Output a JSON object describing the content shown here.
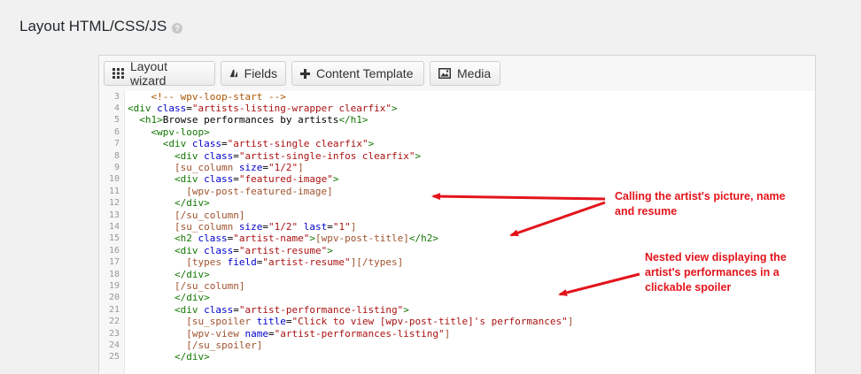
{
  "section": {
    "title": "Layout HTML/CSS/JS",
    "help_icon": "help-icon"
  },
  "toolbar": {
    "buttons": [
      {
        "label": "Layout wizard",
        "icon": "grid-icon"
      },
      {
        "label": "Fields",
        "icon": "fields-icon"
      },
      {
        "label": "Content Template",
        "icon": "plus-icon"
      },
      {
        "label": "Media",
        "icon": "image-icon"
      }
    ]
  },
  "colors": {
    "tag": "#117700",
    "attr": "#0000cc",
    "string": "#aa1111",
    "shortcode": "#a0522d",
    "annotation": "#e3141b"
  },
  "code": {
    "lines": [
      {
        "n": "3",
        "indent": "    ",
        "tokens": [
          [
            "cmt",
            "<!-- wpv-loop-start -->"
          ]
        ]
      },
      {
        "n": "4",
        "indent": "",
        "tokens": [
          [
            "tag",
            "<div "
          ],
          [
            "attr",
            "class"
          ],
          [
            "txt",
            "="
          ],
          [
            "str",
            "\"artists-listing-wrapper clearfix\""
          ],
          [
            "tag",
            ">"
          ]
        ]
      },
      {
        "n": "5",
        "indent": "  ",
        "tokens": [
          [
            "tag",
            "<h1>"
          ],
          [
            "txt",
            "Browse performances by artists"
          ],
          [
            "tag",
            "</h1>"
          ]
        ]
      },
      {
        "n": "6",
        "indent": "    ",
        "tokens": [
          [
            "tag",
            "<wpv-loop>"
          ]
        ]
      },
      {
        "n": "7",
        "indent": "      ",
        "tokens": [
          [
            "tag",
            "<div "
          ],
          [
            "attr",
            "class"
          ],
          [
            "txt",
            "="
          ],
          [
            "str",
            "\"artist-single clearfix\""
          ],
          [
            "tag",
            ">"
          ]
        ]
      },
      {
        "n": "8",
        "indent": "        ",
        "tokens": [
          [
            "tag",
            "<div "
          ],
          [
            "attr",
            "class"
          ],
          [
            "txt",
            "="
          ],
          [
            "str",
            "\"artist-single-infos clearfix\""
          ],
          [
            "tag",
            ">"
          ]
        ]
      },
      {
        "n": "9",
        "indent": "        ",
        "tokens": [
          [
            "sc",
            "[su_column "
          ],
          [
            "attr",
            "size"
          ],
          [
            "txt",
            "="
          ],
          [
            "str",
            "\"1/2\""
          ],
          [
            "sc",
            "]"
          ]
        ]
      },
      {
        "n": "10",
        "indent": "        ",
        "tokens": [
          [
            "tag",
            "<div "
          ],
          [
            "attr",
            "class"
          ],
          [
            "txt",
            "="
          ],
          [
            "str",
            "\"featured-image\""
          ],
          [
            "tag",
            ">"
          ]
        ]
      },
      {
        "n": "11",
        "indent": "          ",
        "tokens": [
          [
            "sc",
            "[wpv-post-featured-image]"
          ]
        ]
      },
      {
        "n": "12",
        "indent": "        ",
        "tokens": [
          [
            "tag",
            "</div>"
          ]
        ]
      },
      {
        "n": "13",
        "indent": "        ",
        "tokens": [
          [
            "sc",
            "[/su_column]"
          ]
        ]
      },
      {
        "n": "14",
        "indent": "        ",
        "tokens": [
          [
            "sc",
            "[su_column "
          ],
          [
            "attr",
            "size"
          ],
          [
            "txt",
            "="
          ],
          [
            "str",
            "\"1/2\""
          ],
          [
            "txt",
            " "
          ],
          [
            "attr",
            "last"
          ],
          [
            "txt",
            "="
          ],
          [
            "str",
            "\"1\""
          ],
          [
            "sc",
            "]"
          ]
        ]
      },
      {
        "n": "15",
        "indent": "        ",
        "tokens": [
          [
            "tag",
            "<h2 "
          ],
          [
            "attr",
            "class"
          ],
          [
            "txt",
            "="
          ],
          [
            "str",
            "\"artist-name\""
          ],
          [
            "tag",
            ">"
          ],
          [
            "sc",
            "[wpv-post-title]"
          ],
          [
            "tag",
            "</h2>"
          ]
        ]
      },
      {
        "n": "16",
        "indent": "        ",
        "tokens": [
          [
            "tag",
            "<div "
          ],
          [
            "attr",
            "class"
          ],
          [
            "txt",
            "="
          ],
          [
            "str",
            "\"artist-resume\""
          ],
          [
            "tag",
            ">"
          ]
        ]
      },
      {
        "n": "17",
        "indent": "          ",
        "tokens": [
          [
            "sc",
            "[types "
          ],
          [
            "attr",
            "field"
          ],
          [
            "txt",
            "="
          ],
          [
            "str",
            "\"artist-resume\""
          ],
          [
            "sc",
            "][/types]"
          ]
        ]
      },
      {
        "n": "18",
        "indent": "        ",
        "tokens": [
          [
            "tag",
            "</div>"
          ]
        ]
      },
      {
        "n": "19",
        "indent": "        ",
        "tokens": [
          [
            "sc",
            "[/su_column]"
          ]
        ]
      },
      {
        "n": "20",
        "indent": "        ",
        "tokens": [
          [
            "tag",
            "</div>"
          ]
        ]
      },
      {
        "n": "21",
        "indent": "        ",
        "tokens": [
          [
            "tag",
            "<div "
          ],
          [
            "attr",
            "class"
          ],
          [
            "txt",
            "="
          ],
          [
            "str",
            "\"artist-performance-listing\""
          ],
          [
            "tag",
            ">"
          ]
        ]
      },
      {
        "n": "22",
        "indent": "          ",
        "tokens": [
          [
            "sc",
            "[su_spoiler "
          ],
          [
            "attr",
            "title"
          ],
          [
            "txt",
            "="
          ],
          [
            "str",
            "\"Click to view [wpv-post-title]'s performances\""
          ],
          [
            "sc",
            "]"
          ]
        ]
      },
      {
        "n": "23",
        "indent": "          ",
        "tokens": [
          [
            "sc",
            "[wpv-view "
          ],
          [
            "attr",
            "name"
          ],
          [
            "txt",
            "="
          ],
          [
            "str",
            "\"artist-performances-listing\""
          ],
          [
            "sc",
            "]"
          ]
        ]
      },
      {
        "n": "24",
        "indent": "          ",
        "tokens": [
          [
            "sc",
            "[/su_spoiler]"
          ]
        ]
      },
      {
        "n": "25",
        "indent": "        ",
        "tokens": [
          [
            "tag",
            "</div>"
          ]
        ]
      }
    ]
  },
  "annotations": {
    "picture": "Calling the artist's picture, name and resume",
    "nested": "Nested view displaying the artist's performances in a clickable spoiler"
  }
}
